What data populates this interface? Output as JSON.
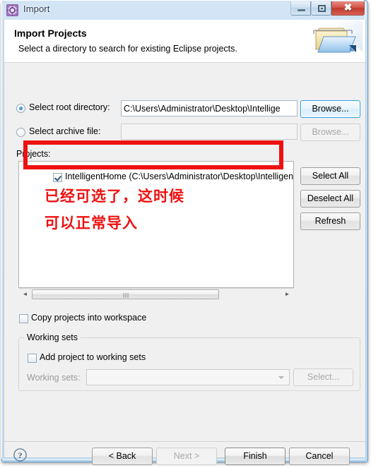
{
  "window": {
    "title": "Import",
    "icon": "eclipse-import-icon",
    "controls": {
      "minimize": "minimize-icon",
      "maximize": "maximize-icon",
      "close": "close-icon"
    }
  },
  "banner": {
    "title": "Import Projects",
    "subtitle": "Select a directory to search for existing Eclipse projects.",
    "icon": "folder-import-icon"
  },
  "source": {
    "root_radio_label": "Select root directory:",
    "root_radio_selected": true,
    "root_value": "C:\\Users\\Administrator\\Desktop\\Intellige",
    "root_browse_label": "Browse...",
    "archive_radio_label": "Select archive file:",
    "archive_radio_selected": false,
    "archive_value": "",
    "archive_browse_label": "Browse..."
  },
  "projects": {
    "label": "Projects:",
    "items": [
      {
        "checked": true,
        "label": "IntelligentHome (C:\\Users\\Administrator\\Desktop\\Intelligen"
      }
    ],
    "buttons": {
      "select_all": "Select All",
      "deselect_all": "Deselect All",
      "refresh": "Refresh"
    },
    "scrollbar": {
      "left_arrow": "◄",
      "right_arrow": "►"
    }
  },
  "options": {
    "copy_projects_label": "Copy projects into workspace",
    "copy_projects_checked": false
  },
  "working_sets": {
    "group_title": "Working sets",
    "add_checkbox_label": "Add project to working sets",
    "add_checkbox_checked": false,
    "combo_label": "Working sets:",
    "combo_value": "",
    "select_button": "Select..."
  },
  "footer": {
    "help_icon": "help-icon",
    "back": "< Back",
    "next": "Next >",
    "finish": "Finish",
    "cancel": "Cancel"
  },
  "annotation": {
    "line1": "已经可选了，这时候",
    "line2": "可以正常导入",
    "color": "#ee1111"
  }
}
